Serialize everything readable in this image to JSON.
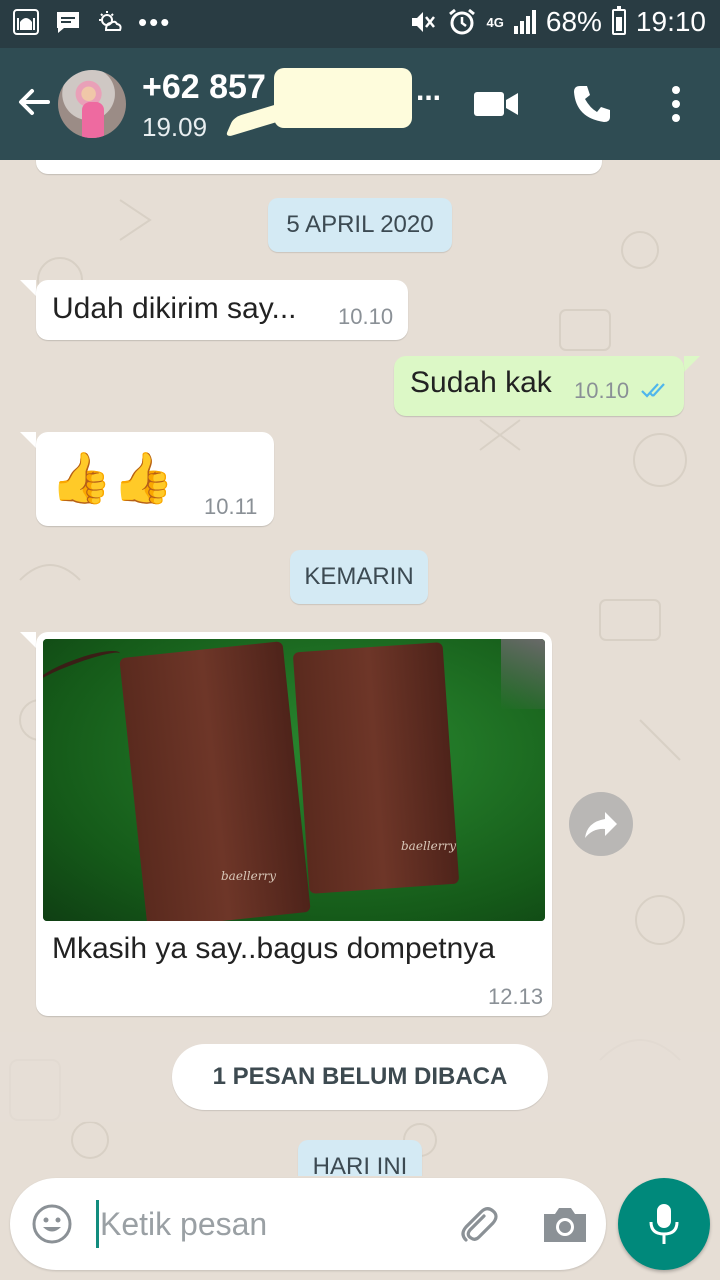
{
  "status_bar": {
    "left_icons": [
      "mosque-icon",
      "message-icon",
      "weather-icon"
    ],
    "more": "•••",
    "network": "4G",
    "battery": "68%",
    "time": "19:10"
  },
  "header": {
    "contact_name": "+62 857",
    "ellipsis": "...",
    "last_seen": "19.09"
  },
  "messages": [
    {
      "type": "date",
      "text": "5 APRIL 2020"
    },
    {
      "type": "incoming",
      "text": "Udah dikirim say...",
      "time": "10.10"
    },
    {
      "type": "outgoing",
      "text": "Sudah kak",
      "time": "10.10",
      "status": "read"
    },
    {
      "type": "incoming",
      "text": "👍👍",
      "time": "10.11"
    },
    {
      "type": "date",
      "text": "KEMARIN"
    },
    {
      "type": "incoming-image",
      "caption": "Mkasih ya say..bagus dompetnya",
      "time": "12.13",
      "image_text_left": "baellerry",
      "image_text_right": "baellerry"
    }
  ],
  "unread_banner": "1 PESAN BELUM DIBACA",
  "today_label": "HARI INI",
  "composer": {
    "placeholder": "Ketik pesan"
  },
  "colors": {
    "header": "#2f4c53",
    "outgoing_bubble": "#dcf8c6",
    "accent": "#00897b",
    "read_ticks": "#4fb6ec"
  }
}
